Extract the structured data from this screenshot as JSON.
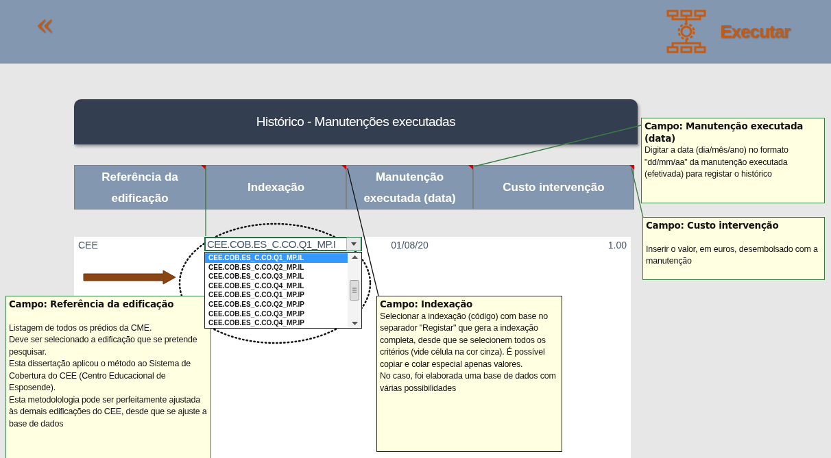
{
  "topbar": {
    "back": "«",
    "action": "Executar"
  },
  "banner": {
    "title": "Histórico - Manutenções executadas"
  },
  "table": {
    "columns": [
      {
        "label": "Referência da edificação",
        "comment": true
      },
      {
        "label": "Indexação",
        "comment": true
      },
      {
        "label": "Manutenção executada (data)",
        "comment": true
      },
      {
        "label": "Custo intervenção",
        "comment": true
      }
    ],
    "rows": [
      {
        "reference": "CEE",
        "indexation": "CEE.COB.ES_C.CO.Q1_MP.I",
        "date": "01/08/20",
        "cost": "1.00"
      }
    ]
  },
  "dropdown": {
    "expanded": true,
    "items": [
      {
        "label": "CEE.COB.ES_C.CO.Q1_MP.IL",
        "selected": true
      },
      {
        "label": "CEE.COB.ES_C.CO.Q2_MP.IL",
        "selected": false
      },
      {
        "label": "CEE.COB.ES_C.CO.Q3_MP.IL",
        "selected": false
      },
      {
        "label": "CEE.COB.ES_C.CO.Q4_MP.IL",
        "selected": false
      },
      {
        "label": "CEE.COB.ES_C.CO.Q1_MP.IP",
        "selected": false
      },
      {
        "label": "CEE.COB.ES_C.CO.Q2_MP.IP",
        "selected": false
      },
      {
        "label": "CEE.COB.ES_C.CO.Q3_MP.IP",
        "selected": false
      },
      {
        "label": "CEE.COB.ES_C.CO.Q4_MP.IP",
        "selected": false
      }
    ]
  },
  "comments": [
    {
      "title": "Campo: Manutenção executada (data)",
      "spaced": false,
      "paragraphs": [
        "Digitar a data (dia/mês/ano)  no formato \"dd/mm/aa\" da manutenção executada (efetivada) para registar o histórico"
      ]
    },
    {
      "title": "Campo: Custo intervenção",
      "spaced": true,
      "paragraphs": [
        "Inserir o valor, em euros, desembolsado com a manutenção"
      ]
    },
    {
      "title": "Campo: Referência da edificação",
      "spaced": true,
      "paragraphs": [
        "Listagem de todos os prédios da CME.",
        "Deve ser selecionado a edificação que se pretende pesquisar.",
        "Esta dissertação aplicou o método ao Sistema de Cobertura do CEE (Centro Educacional de Esposende).",
        "Esta metodolologia pode ser perfeitamente ajustada às demais edificações do CEE, desde que se ajuste a base de dados"
      ]
    },
    {
      "title": "Campo: Indexação",
      "spaced": false,
      "paragraphs": [
        "Selecionar a indexação (código) com base no separador \"Registar\" que gera a indexação completa, desde que se selecionem todos os critérios (vide célula na cor cinza). É possível copiar e colar especial apenas valores.",
        "No caso, foi elaborada uma base de dados com várias possibilidades"
      ]
    }
  ]
}
